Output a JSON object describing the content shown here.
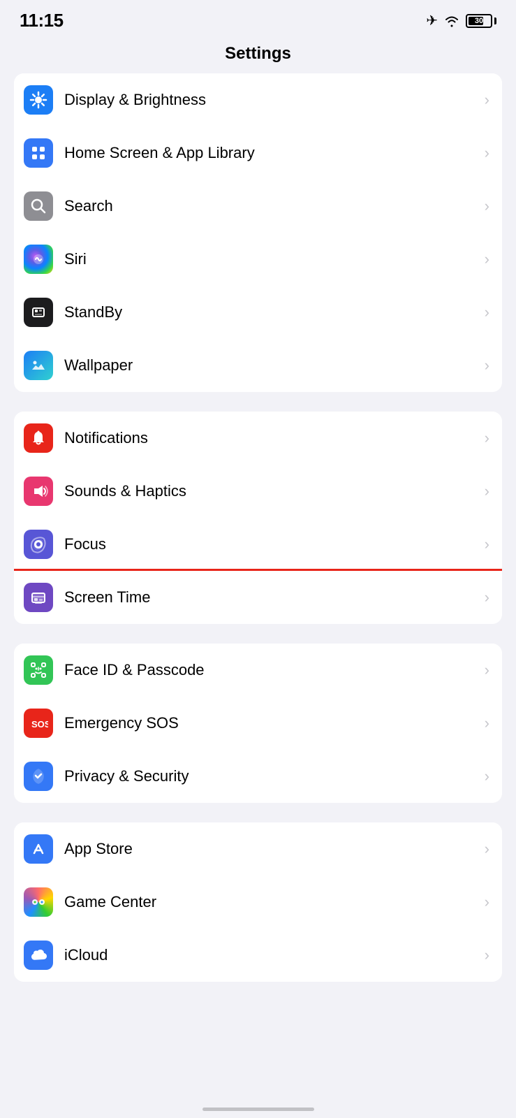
{
  "statusBar": {
    "time": "11:15",
    "battery": "30"
  },
  "pageTitle": "Settings",
  "groups": [
    {
      "id": "group1",
      "rows": [
        {
          "id": "display",
          "label": "Display & Brightness",
          "icon": "sun",
          "iconBg": "icon-blue"
        },
        {
          "id": "homescreen",
          "label": "Home Screen & App Library",
          "icon": "homescreen",
          "iconBg": "icon-blue2"
        },
        {
          "id": "search",
          "label": "Search",
          "icon": "search",
          "iconBg": "icon-gray"
        },
        {
          "id": "siri",
          "label": "Siri",
          "icon": "siri",
          "iconBg": "siri-icon"
        },
        {
          "id": "standby",
          "label": "StandBy",
          "icon": "standby",
          "iconBg": "icon-black"
        },
        {
          "id": "wallpaper",
          "label": "Wallpaper",
          "icon": "wallpaper",
          "iconBg": "wallpaper-icon"
        }
      ]
    },
    {
      "id": "group2",
      "rows": [
        {
          "id": "notifications",
          "label": "Notifications",
          "icon": "bell",
          "iconBg": "icon-red"
        },
        {
          "id": "sounds",
          "label": "Sounds & Haptics",
          "icon": "speaker",
          "iconBg": "icon-pink"
        },
        {
          "id": "focus",
          "label": "Focus",
          "icon": "moon",
          "iconBg": "icon-indigo"
        },
        {
          "id": "screentime",
          "label": "Screen Time",
          "icon": "hourglass",
          "iconBg": "icon-purple2",
          "highlighted": true
        }
      ]
    },
    {
      "id": "group3",
      "rows": [
        {
          "id": "faceid",
          "label": "Face ID & Passcode",
          "icon": "faceid",
          "iconBg": "icon-green"
        },
        {
          "id": "sos",
          "label": "Emergency SOS",
          "icon": "sos",
          "iconBg": "icon-red"
        },
        {
          "id": "privacy",
          "label": "Privacy & Security",
          "icon": "hand",
          "iconBg": "icon-blue2"
        }
      ]
    },
    {
      "id": "group4",
      "rows": [
        {
          "id": "appstore",
          "label": "App Store",
          "icon": "appstore",
          "iconBg": "icon-blue2"
        },
        {
          "id": "gamecenter",
          "label": "Game Center",
          "icon": "gamecenter",
          "iconBg": "gamecenter-icon"
        },
        {
          "id": "icloud",
          "label": "iCloud",
          "icon": "icloud",
          "iconBg": "icloud-icon"
        }
      ]
    }
  ],
  "chevron": "›"
}
